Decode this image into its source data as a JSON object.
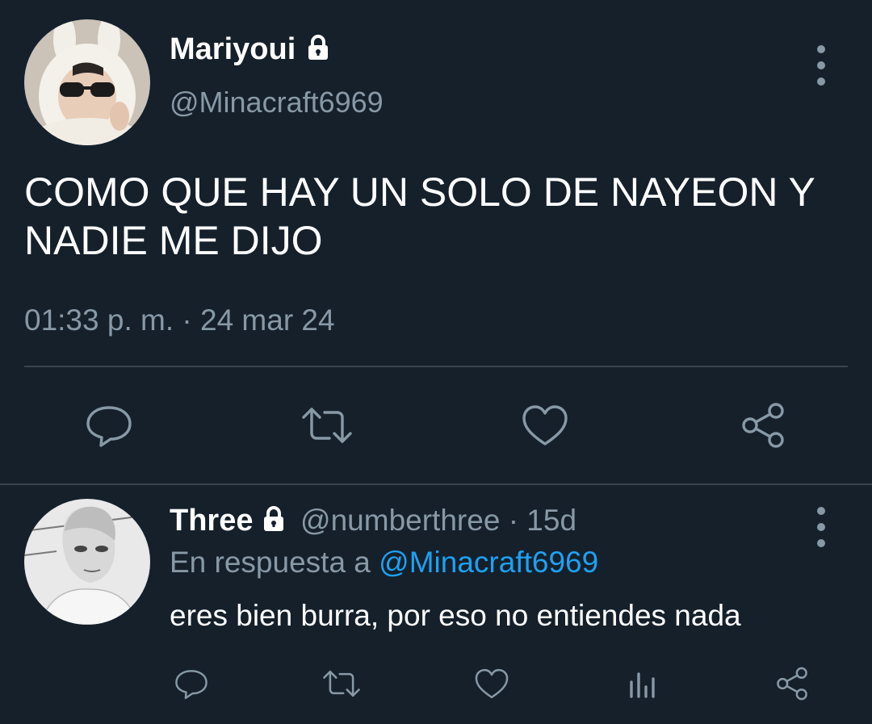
{
  "main_tweet": {
    "display_name": "Mariyoui",
    "handle": "@Minacraft6969",
    "text_line1": "COMO QUE HAY UN SOLO DE NAYEON Y",
    "text_line2": "NADIE ME DIJO",
    "timestamp": "01:33 p. m. · 24 mar 24",
    "actions": [
      "reply-icon",
      "retweet-icon",
      "like-icon",
      "share-icon"
    ]
  },
  "reply": {
    "display_name": "Three",
    "handle": "@numberthree",
    "age": "· 15d",
    "reply_prefix": "En respuesta a",
    "reply_to": "@Minacraft6969",
    "text": "eres bien burra, por eso no entiendes nada",
    "actions": [
      "reply-icon",
      "retweet-icon",
      "like-icon",
      "analytics-icon",
      "share-icon"
    ]
  },
  "colors": {
    "background": "#15202b",
    "muted": "#8899a6",
    "link": "#1da1f2",
    "divider": "#38444d"
  }
}
